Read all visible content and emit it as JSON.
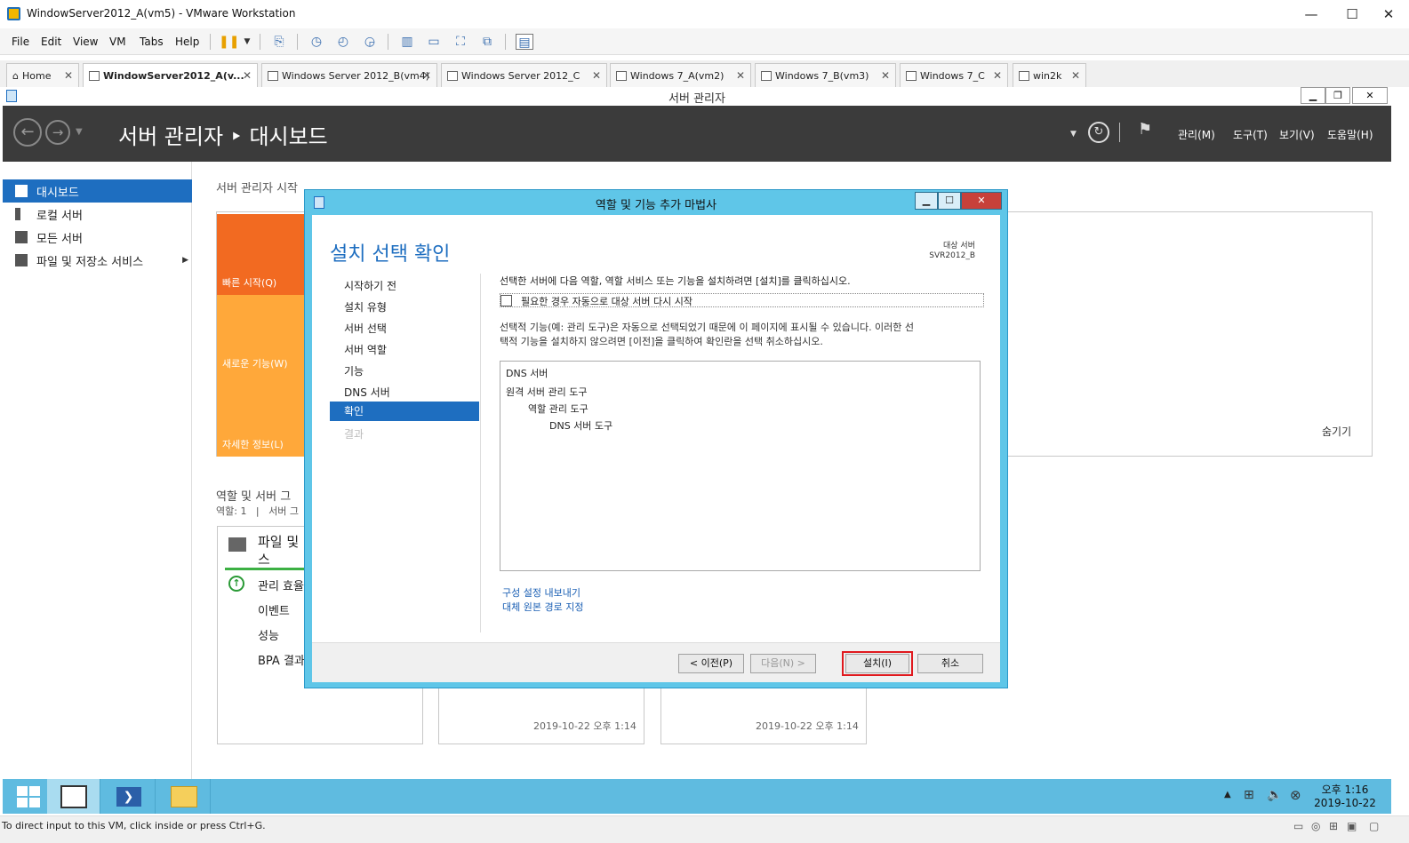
{
  "window": {
    "title": "WindowServer2012_A(vm5) - VMware Workstation",
    "min": "—",
    "max": "☐",
    "close": "✕"
  },
  "menu": [
    "File",
    "Edit",
    "View",
    "VM",
    "Tabs",
    "Help"
  ],
  "tabs": [
    {
      "label": "Home"
    },
    {
      "label": "WindowServer2012_A(v..."
    },
    {
      "label": "Windows Server 2012_B(vm4)"
    },
    {
      "label": "Windows Server 2012_C"
    },
    {
      "label": "Windows 7_A(vm2)"
    },
    {
      "label": "Windows 7_B(vm3)"
    },
    {
      "label": "Windows 7_C"
    },
    {
      "label": "win2k"
    }
  ],
  "tab_close": "✕",
  "server_manager": {
    "title": "서버 관리자",
    "breadcrumb": "서버 관리자 ‣ 대시보드",
    "header_menus": [
      "관리(M)",
      "도구(T)",
      "보기(V)",
      "도움말(H)"
    ],
    "sidebar": [
      {
        "label": "대시보드"
      },
      {
        "label": "로컬 서버"
      },
      {
        "label": "모든 서버"
      },
      {
        "label": "파일 및 저장소 서비스"
      }
    ],
    "welcome_heading": "서버 관리자 시작",
    "tiles": [
      "빠른 시작(Q)",
      "새로운 기능(W)",
      "자세한 정보(L)"
    ],
    "hide_label": "숨기기",
    "roles_heading": "역할 및 서버 그",
    "roles_sub": "역할: 1   |   서버 그",
    "card": {
      "title_line1": "파일 및",
      "title_line2": "스",
      "rows": [
        "관리 효율",
        "이벤트",
        "성능",
        "BPA 결과"
      ]
    },
    "timestamps": [
      "2019-10-22 오후 1:14",
      "2019-10-22 오후 1:14"
    ]
  },
  "wizard": {
    "title": "역할 및 기능 추가 마법사",
    "page_title": "설치 선택 확인",
    "target_label": "대상 서버",
    "target_server": "SVR2012_B",
    "steps": [
      {
        "label": "시작하기 전"
      },
      {
        "label": "설치 유형"
      },
      {
        "label": "서버 선택"
      },
      {
        "label": "서버 역할"
      },
      {
        "label": "기능"
      },
      {
        "label": "DNS 서버"
      },
      {
        "label": "확인"
      },
      {
        "label": "결과"
      }
    ],
    "intro": "선택한 서버에 다음 역할, 역할 서비스 또는 기능을 설치하려면 [설치]를 클릭하십시오.",
    "restart_checkbox": "필요한 경우 자동으로 대상 서버 다시 시작",
    "restart_checked": false,
    "note_line1": "선택적 기능(예: 관리 도구)은 자동으로 선택되었기 때문에 이 페이지에 표시될 수 있습니다. 이러한 선",
    "note_line2": "택적 기능을 설치하지 않으려면 [이전]을 클릭하여 확인란을 선택 취소하십시오.",
    "features": [
      {
        "label": "DNS 서버",
        "level": 0
      },
      {
        "label": "원격 서버 관리 도구",
        "level": 0
      },
      {
        "label": "역할 관리 도구",
        "level": 1
      },
      {
        "label": "DNS 서버 도구",
        "level": 2
      }
    ],
    "link_export": "구성 설정 내보내기",
    "link_source": "대체 원본 경로 지정",
    "btn_prev": "< 이전(P)",
    "btn_next": "다음(N) >",
    "btn_install": "설치(I)",
    "btn_cancel": "취소"
  },
  "taskbar": {
    "time": "오후 1:16",
    "date": "2019-10-22"
  },
  "status_text": "To direct input to this VM, click inside or press Ctrl+G.",
  "colors": {
    "accent": "#1e6ec0",
    "wizard_frame": "#5fc6e8",
    "tile_orange": "#f26a21",
    "tile_amber": "#ffa83a",
    "install_highlight": "#e0191e"
  }
}
